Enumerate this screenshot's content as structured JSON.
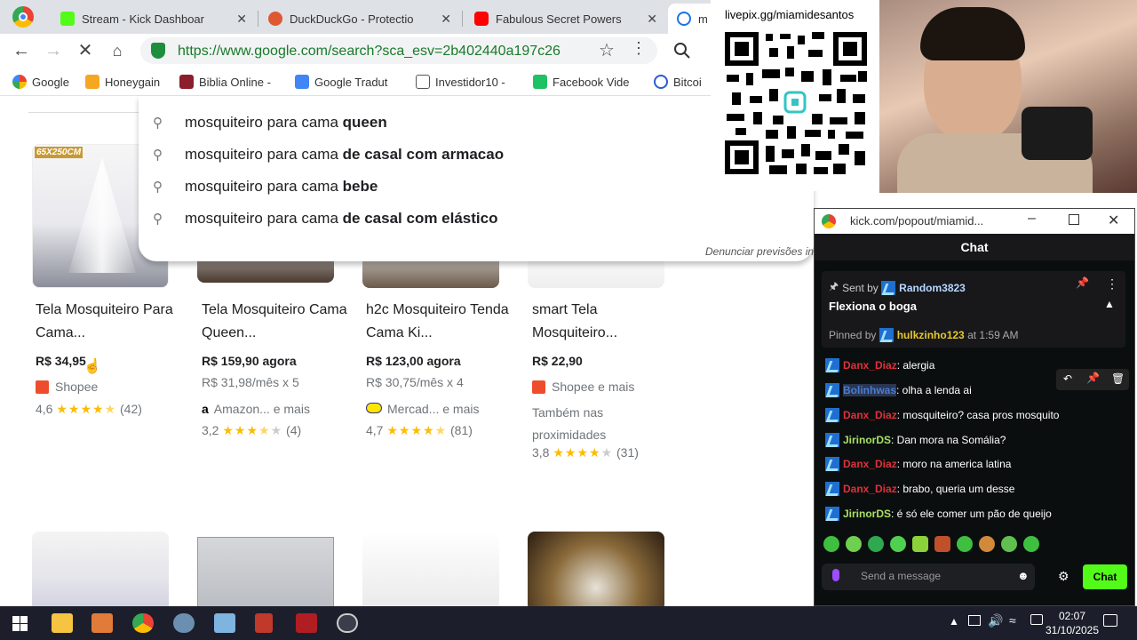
{
  "tabs": [
    {
      "title": "Stream - Kick Dashboar",
      "close": "✕"
    },
    {
      "title": "DuckDuckGo - Protectio",
      "close": "✕"
    },
    {
      "title": "Fabulous Secret Powers",
      "close": "✕"
    },
    {
      "title": "m",
      "close": ""
    }
  ],
  "toolbar": {
    "url": "https://www.google.com/search?sca_esv=2b402440a197c26"
  },
  "bookmarks": [
    {
      "label": "Google"
    },
    {
      "label": "Honeygain"
    },
    {
      "label": "Biblia Online -"
    },
    {
      "label": "Google Tradut"
    },
    {
      "label": "Investidor10 -"
    },
    {
      "label": "Facebook Vide"
    },
    {
      "label": "Bitcoi"
    }
  ],
  "suggestions": [
    {
      "prefix": "mosquiteiro para cama",
      "bold": "queen"
    },
    {
      "prefix": "mosquiteiro para cama",
      "bold": "de casal com armacao"
    },
    {
      "prefix": "mosquiteiro para cama",
      "bold": "bebe"
    },
    {
      "prefix": "mosquiteiro para cama",
      "bold": "de casal com elástico"
    }
  ],
  "report_text": "Denunciar previsões in",
  "products": [
    {
      "badge": "65X250CM",
      "title": "Tela Mosquiteiro Para Cama...",
      "price": "R$ 34,95",
      "installment": "",
      "store": "Shopee",
      "extra": "",
      "rating": "4,6",
      "stars": 4.5,
      "reviews": "(42)"
    },
    {
      "badge": "",
      "title": "Tela Mosquiteiro Cama Queen...",
      "price": "R$ 159,90 agora",
      "installment": "R$ 31,98/mês x 5",
      "store": "Amazon... e mais",
      "extra": "",
      "rating": "3,2",
      "stars": 3.5,
      "reviews": "(4)"
    },
    {
      "badge": "",
      "title": "h2c Mosquiteiro Tenda Cama Ki...",
      "price": "R$ 123,00 agora",
      "installment": "R$ 30,75/mês x 4",
      "store": "Mercad... e mais",
      "extra": "",
      "rating": "4,7",
      "stars": 4.5,
      "reviews": "(81)"
    },
    {
      "badge": "",
      "title": "smart Tela Mosquiteiro...",
      "price": "R$ 22,90",
      "installment": "",
      "store": "Shopee e mais",
      "extra": "Também nas proximidades",
      "rating": "3,8",
      "stars": 4,
      "reviews": "(31)"
    }
  ],
  "overlay": {
    "livepix": "livepix.gg/miamidesantos"
  },
  "chat": {
    "window_title": "kick.com/popout/miamid...",
    "header": "Chat",
    "pinned": {
      "sent_by_label": "Sent by",
      "sent_by_user": "Random3823",
      "text": "Flexiona o boga",
      "pinned_by_label": "Pinned by",
      "pinned_by_user": "hulkzinho123",
      "pinned_at": "at 1:59 AM"
    },
    "messages": [
      {
        "user": "Danx_Diaz",
        "color": "#e0303a",
        "text": ": alergia"
      },
      {
        "user": "Bolinhwas",
        "color": "#4a7bd4",
        "text": ": olha a lenda ai"
      },
      {
        "user": "Danx_Diaz",
        "color": "#e0303a",
        "text": ": mosquiteiro? casa pros mosquito"
      },
      {
        "user": "JirinorDS",
        "color": "#a8e063",
        "text": ": Dan mora na Somália?"
      },
      {
        "user": "Danx_Diaz",
        "color": "#e0303a",
        "text": ": moro na america latina"
      },
      {
        "user": "Danx_Diaz",
        "color": "#e0303a",
        "text": ": brabo, queria um desse"
      },
      {
        "user": "JirinorDS",
        "color": "#a8e063",
        "text": ": é só ele comer um pão de queijo"
      }
    ],
    "input_placeholder": "Send a message",
    "send_label": "Chat"
  },
  "taskbar": {
    "time": "02:07",
    "date": "31/10/2025"
  }
}
